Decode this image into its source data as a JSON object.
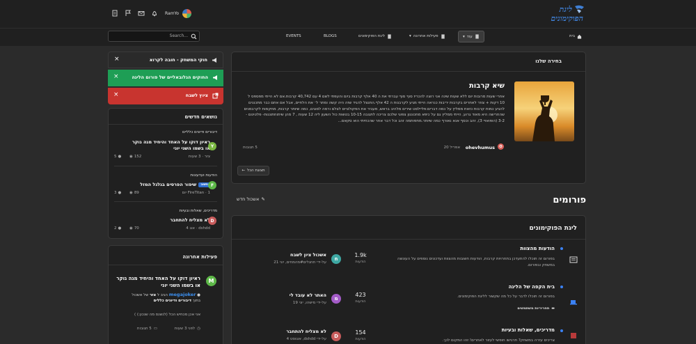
{
  "header": {
    "logo_line1": "ליגת",
    "logo_line2": "הפוקימונים",
    "username": "RamYo",
    "search_placeholder": "Search..."
  },
  "nav": {
    "home": "בית",
    "more": "עוד",
    "activity": "פעילות אחרונה",
    "league": "ליגת הפוקימונים",
    "blogs": "BLOGS",
    "events": "EVENTS"
  },
  "notices": [
    {
      "text": "חוקי המשחק - חובה לקרוא",
      "color": "#2a2a2a"
    },
    {
      "text": "החוקים הגלובאליים של פורום הליגה",
      "color": "#1e9e55"
    },
    {
      "text": "ציוץ לשבח",
      "color": "#c8342f"
    }
  ],
  "featured": {
    "panel_title": "בחירה שלנו",
    "title": "שיא קרבות",
    "body": "אחרי שעות מרובות יום ללא שעות שינה אני רוצה להכריז סוף סוף עברתי את ה 40 אלף קרבות ביום והעפתי לשם 4 עם 40,742 קרבות.אם לא הייתי מפספס ל 10 דקות + צוזר לאחרים בקרבות יריבות כנראה הייתי מגיע לקרבנות ה 42 אלף.התנצל להגיד שזה היה קשה ומתר ל׳ את הלחיים, אבל אם אתם כבר מתכננים להגיע כמות קרבות כזאת ממליץ על כמה דברים:פליילסט שירים מלהיב בראש, מעביר את הפקולוניים לצלם ורמה לסוגים, כמה שיותר קרבות, מחקמות לקרבמנים שהחרישה היא מאוד גרוע, הייתי ממליץ גם על כיפא מחכוננון צפוגי שלכם צריכה לתגובה 10-15 בטשות כול השעון ליה 12 שעות , 7 מהן שיתוחתוננות- פלטינום - 3-2 (הופואויי 3), זהב וכסף אנא נאורף כמה שיותר.מחפותמה זהב וכל דבר אחר שהכחיתי הוא סקאם...",
    "author": "ohevhumus",
    "date": "אפריל 20",
    "replies": "5 תגובות",
    "view_all": "תצוגת הכל"
  },
  "forums_header": {
    "title": "פורומים",
    "mark_read": "אשכול חדש"
  },
  "category": {
    "title": "ליגת הפוקימונים",
    "forums": [
      {
        "name": "הודעות מהצוות",
        "desc": "בפורום זה תוכלו להתעדכן בתחרויות קרבות, הודעות חשובות מהצוות ועדכונים נוספים על העונשה במשחק ובפורום.",
        "count": "1.9k",
        "count_label": "הודעות",
        "last_title": "אשכול ציון לשבח",
        "last_by": "על-ידי תחגלים#מהמחים, יוני 21",
        "avatar_letter": "ח",
        "avatar_color": "#3ea8a3",
        "sub": ""
      },
      {
        "name": "בית הקפה של הליגה",
        "desc": "בפורום זה תוכלו לדבר על כל מה שקשור לליגת הפוקימונים.",
        "count": "423",
        "count_label": "הודעות",
        "last_title": "האתר לא עובד לי",
        "last_by": "על-ידי מישהו, יוני 19",
        "avatar_letter": "מ",
        "avatar_color": "#a35bc7",
        "sub": "תחריריות משתמשים"
      },
      {
        "name": "מדריכים, שאלות ובעיות",
        "desc": "צריכים עזרה במשחק? תרגישו חופשי לעזור לאחרים! זהו המקום לכך.",
        "count": "154",
        "count_label": "הודעות",
        "last_title": "לא מצליח להתחבר",
        "last_by": "על-ידי dshdd, אוגוסט 4",
        "avatar_letter": "D",
        "avatar_color": "#c75b5b",
        "sub": ""
      }
    ]
  },
  "new_topics": {
    "title": "נושאים חדשים",
    "items": [
      {
        "forum": "דיבורים ודיונים כלליים",
        "title": "ראיון דוקו על האחד והיחיד מגה גוקר או בשמו השני יוני",
        "meta": "צזר · 3 שעות",
        "views": "152",
        "replies": "5",
        "letter": "Y",
        "color": "#7bb842",
        "badge": ""
      },
      {
        "forum": "הודעות ועדעונות",
        "title": "שיפור הפרסים בגלגל המזל",
        "meta": "FireTitan · 1 יום",
        "views": "89",
        "replies": "3",
        "letter": "F",
        "color": "#5db848",
        "badge": "חשוב"
      },
      {
        "forum": "מדריכים, שאלות ובעיות",
        "title": "לא מצליח להתחבר",
        "meta": "dshdd · אוג 4",
        "views": "70",
        "replies": "2",
        "letter": "D",
        "color": "#c75b5b",
        "badge": ""
      }
    ]
  },
  "recent_activity": {
    "title": "פעילות אחרונה",
    "item_title": "ראיון דוקו על האחד והיחיד מגה גוקר או בשמו השני יוני",
    "user": "megajoker",
    "action_mid": "הגיב ל",
    "action_obj": "צזר",
    "action_tail": "של אשכול",
    "in_label": "בתוך",
    "in_forum": "דיבורים ודיונים כללים",
    "quote": "אני אכן מכחיש הכל (לנשנס מה שנכון:) )",
    "time": "לפני 3 שעות",
    "replies": "5 תגובות",
    "letter": "M"
  }
}
